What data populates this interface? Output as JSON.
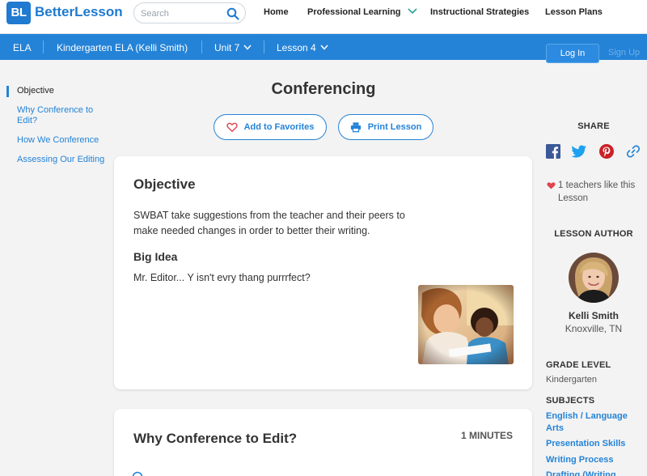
{
  "header": {
    "logo_mark": "BL",
    "logo_text": "BetterLesson",
    "search_placeholder": "Search",
    "nav": [
      {
        "label": "Home"
      },
      {
        "label": "Professional Learning"
      },
      {
        "label": "Instructional Strategies"
      },
      {
        "label": "Lesson Plans"
      }
    ]
  },
  "breadcrumb": {
    "items": [
      {
        "label": "ELA"
      },
      {
        "label": "Kindergarten ELA (Kelli Smith)"
      },
      {
        "label": "Unit 7"
      },
      {
        "label": "Lesson 4"
      }
    ],
    "login_label": "Log In",
    "signup_label": "Sign Up"
  },
  "sidenav": {
    "items": [
      {
        "label": "Objective",
        "active": true
      },
      {
        "label": "Why Conference to Edit?"
      },
      {
        "label": "How We Conference"
      },
      {
        "label": "Assessing Our Editing"
      }
    ]
  },
  "lesson": {
    "title": "Conferencing",
    "favorite_label": "Add to Favorites",
    "print_label": "Print Lesson"
  },
  "objective_card": {
    "heading": "Objective",
    "text": "SWBAT take suggestions from the teacher and their peers to make needed changes in order to better their writing.",
    "big_idea_heading": "Big Idea",
    "big_idea_text": "Mr. Editor... Y isn't evry thang purrrfect?"
  },
  "section_card": {
    "heading": "Why Conference to Edit?",
    "minutes": "1 MINUTES"
  },
  "sidebar": {
    "share_heading": "SHARE",
    "share_icons": [
      "facebook-icon",
      "twitter-icon",
      "pinterest-icon",
      "link-icon"
    ],
    "likes_text": "1 teachers like this Lesson",
    "author_heading": "LESSON AUTHOR",
    "author_name": "Kelli Smith",
    "author_location": "Knoxville, TN",
    "grade_heading": "GRADE LEVEL",
    "grade_value": "Kindergarten",
    "subjects_heading": "SUBJECTS",
    "subjects": [
      {
        "label": "English / Language Arts"
      },
      {
        "label": "Presentation Skills"
      },
      {
        "label": "Writing Process"
      },
      {
        "label": "Drafting (Writing"
      }
    ]
  },
  "colors": {
    "brand_blue": "#2483d7",
    "heart_red": "#e0434e",
    "page_bg": "#f3f3f3"
  }
}
